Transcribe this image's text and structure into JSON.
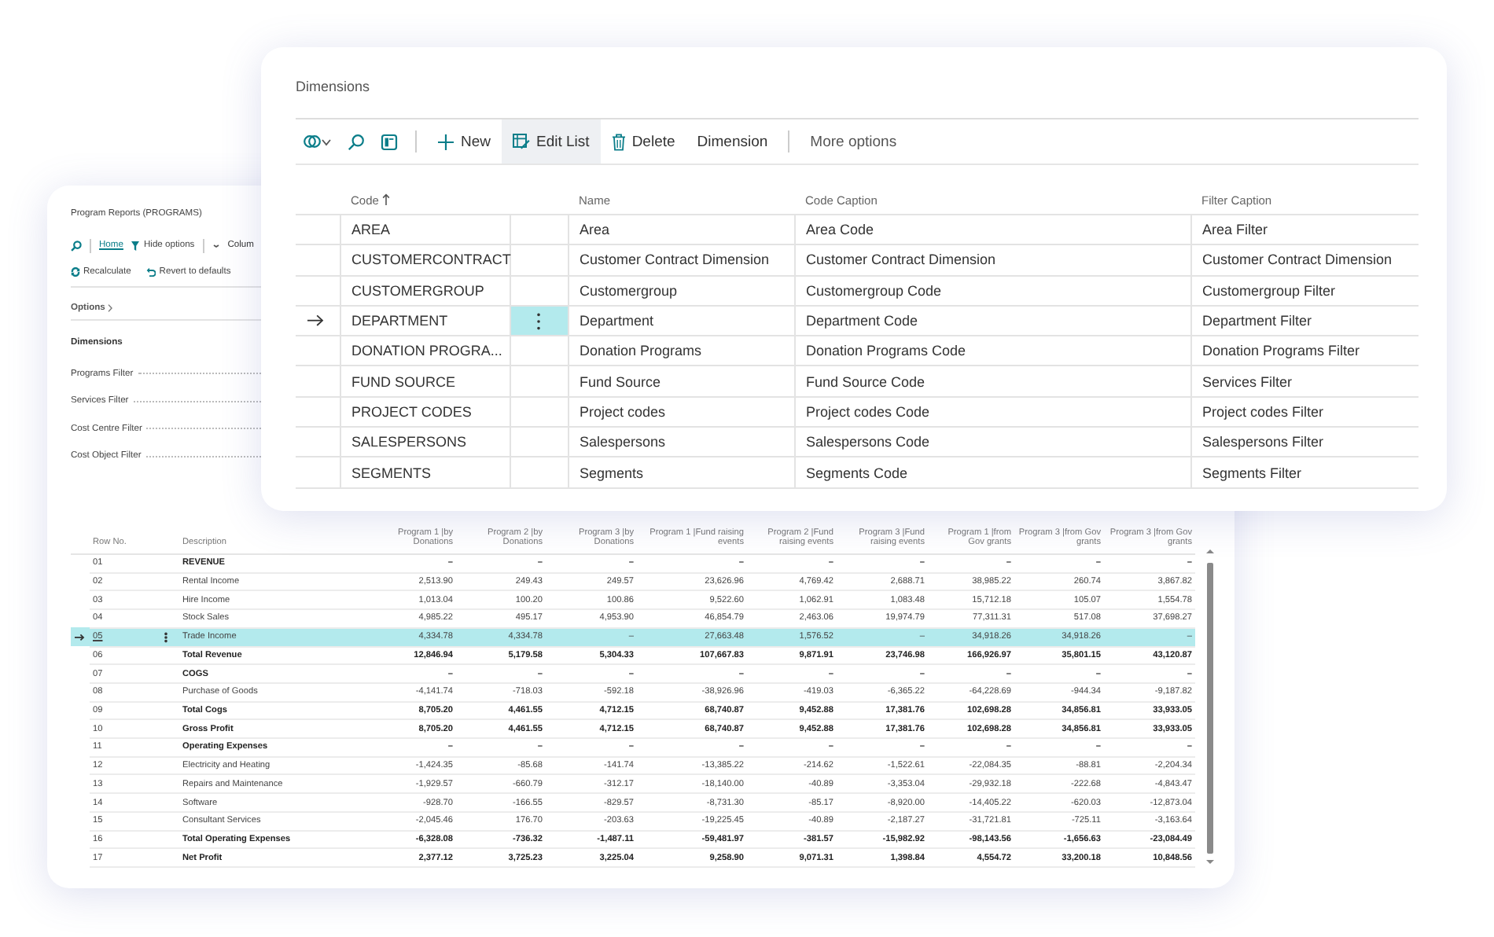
{
  "report_page": {
    "title": "Program Reports (PROGRAMS)",
    "tabs": [
      {
        "label": "Home",
        "selected": true
      }
    ],
    "hide_options": "Hide options",
    "column_cut": "Colum",
    "actions": [
      {
        "kind": "recalculate",
        "label": "Recalculate"
      },
      {
        "kind": "revert",
        "label": "Revert to defaults"
      }
    ],
    "options_label": "Options",
    "dimensions_label": "Dimensions",
    "filters": [
      "Programs Filter",
      "Services Filter",
      "Cost Centre Filter",
      "Cost Object Filter"
    ],
    "table": {
      "columns": [
        "Row No.",
        "Description",
        "Program 1 |by Donations",
        "Program 2 |by Donations",
        "Program 3 |by Donations",
        "Program 1 |Fund raising events",
        "Program 2 |Fund raising events",
        "Program 3 |Fund raising events",
        "Program 1 |from Gov grants",
        "Program 3 |from Gov grants",
        "Program 3 |from Gov grants"
      ],
      "rows": [
        {
          "no": "01",
          "kind": "heading",
          "description": "REVENUE",
          "selected": false,
          "values": [
            "–",
            "–",
            "–",
            "–",
            "–",
            "–",
            "–",
            "–",
            "–"
          ]
        },
        {
          "no": "02",
          "kind": "line",
          "description": "Rental Income",
          "selected": false,
          "values": [
            "2,513.90",
            "249.43",
            "249.57",
            "23,626.96",
            "4,769.42",
            "2,688.71",
            "38,985.22",
            "260.74",
            "3,867.82"
          ]
        },
        {
          "no": "03",
          "kind": "line",
          "description": "Hire Income",
          "selected": false,
          "values": [
            "1,013.04",
            "100.20",
            "100.86",
            "9,522.60",
            "1,062.91",
            "1,083.48",
            "15,712.18",
            "105.07",
            "1,554.78"
          ]
        },
        {
          "no": "04",
          "kind": "line",
          "description": "Stock Sales",
          "selected": false,
          "values": [
            "4,985.22",
            "495.17",
            "4,953.90",
            "46,854.79",
            "2,463.06",
            "19,974.79",
            "77,311.31",
            "517.08",
            "37,698.27"
          ]
        },
        {
          "no": "05",
          "kind": "line",
          "description": "Trade Income",
          "selected": true,
          "values": [
            "4,334.78",
            "4,334.78",
            "–",
            "27,663.48",
            "1,576.52",
            "–",
            "34,918.26",
            "34,918.26",
            "–"
          ]
        },
        {
          "no": "06",
          "kind": "total",
          "description": "Total Revenue",
          "selected": false,
          "values": [
            "12,846.94",
            "5,179.58",
            "5,304.33",
            "107,667.83",
            "9,871.91",
            "23,746.98",
            "166,926.97",
            "35,801.15",
            "43,120.87"
          ]
        },
        {
          "no": "07",
          "kind": "heading",
          "description": "COGS",
          "selected": false,
          "values": [
            "–",
            "–",
            "–",
            "–",
            "–",
            "–",
            "–",
            "–",
            "–"
          ]
        },
        {
          "no": "08",
          "kind": "line",
          "description": "Purchase of Goods",
          "selected": false,
          "values": [
            "-4,141.74",
            "-718.03",
            "-592.18",
            "-38,926.96",
            "-419.03",
            "-6,365.22",
            "-64,228.69",
            "-944.34",
            "-9,187.82"
          ]
        },
        {
          "no": "09",
          "kind": "total",
          "description": "Total Cogs",
          "selected": false,
          "values": [
            "8,705.20",
            "4,461.55",
            "4,712.15",
            "68,740.87",
            "9,452.88",
            "17,381.76",
            "102,698.28",
            "34,856.81",
            "33,933.05"
          ]
        },
        {
          "no": "10",
          "kind": "total",
          "description": "Gross Profit",
          "selected": false,
          "values": [
            "8,705.20",
            "4,461.55",
            "4,712.15",
            "68,740.87",
            "9,452.88",
            "17,381.76",
            "102,698.28",
            "34,856.81",
            "33,933.05"
          ]
        },
        {
          "no": "11",
          "kind": "heading",
          "description": "Operating Expenses",
          "selected": false,
          "values": [
            "–",
            "–",
            "–",
            "–",
            "–",
            "–",
            "–",
            "–",
            "–"
          ]
        },
        {
          "no": "12",
          "kind": "line",
          "description": "Electricity and Heating",
          "selected": false,
          "values": [
            "-1,424.35",
            "-85.68",
            "-141.74",
            "-13,385.22",
            "-214.62",
            "-1,522.61",
            "-22,084.35",
            "-88.81",
            "-2,204.34"
          ]
        },
        {
          "no": "13",
          "kind": "line",
          "description": "Repairs and Maintenance",
          "selected": false,
          "values": [
            "-1,929.57",
            "-660.79",
            "-312.17",
            "-18,140.00",
            "-40.89",
            "-3,353.04",
            "-29,932.18",
            "-222.68",
            "-4,843.47"
          ]
        },
        {
          "no": "14",
          "kind": "line",
          "description": "Software",
          "selected": false,
          "values": [
            "-928.70",
            "-166.55",
            "-829.57",
            "-8,731.30",
            "-85.17",
            "-8,920.00",
            "-14,405.22",
            "-620.03",
            "-12,873.04"
          ]
        },
        {
          "no": "15",
          "kind": "line",
          "description": "Consultant Services",
          "selected": false,
          "values": [
            "-2,045.46",
            "176.70",
            "-203.63",
            "-19,225.45",
            "-40.89",
            "-2,187.27",
            "-31,721.81",
            "-725.11",
            "-3,163.64"
          ]
        },
        {
          "no": "16",
          "kind": "total",
          "description": "Total Operating Expenses",
          "selected": false,
          "values": [
            "-6,328.08",
            "-736.32",
            "-1,487.11",
            "-59,481.97",
            "-381.57",
            "-15,982.92",
            "-98,143.56",
            "-1,656.63",
            "-23,084.49"
          ]
        },
        {
          "no": "17",
          "kind": "net",
          "description": "Net Profit",
          "selected": false,
          "values": [
            "2,377.12",
            "3,725.23",
            "3,225.04",
            "9,258.90",
            "9,071.31",
            "1,398.84",
            "4,554.72",
            "33,200.18",
            "10,848.56"
          ]
        }
      ]
    }
  },
  "dimensions_dialog": {
    "title": "Dimensions",
    "actions": [
      {
        "kind": "new",
        "label": "New",
        "selected": false
      },
      {
        "kind": "edit",
        "label": "Edit List",
        "selected": true
      },
      {
        "kind": "delete",
        "label": "Delete",
        "selected": false
      },
      {
        "kind": "plain",
        "label": "Dimension",
        "selected": false
      },
      {
        "kind": "more",
        "label": "More options",
        "selected": false
      }
    ],
    "table": {
      "columns": [
        "Code",
        "Name",
        "Code Caption",
        "Filter Caption"
      ],
      "rows": [
        {
          "code": "AREA",
          "name": "Area",
          "code_caption": "Area Code",
          "filter_caption": "Area Filter",
          "selected": false
        },
        {
          "code": "CUSTOMERCONTRACT",
          "name": "Customer Contract Dimension",
          "code_caption": "Customer Contract Dimension",
          "filter_caption": "Customer Contract Dimension",
          "selected": false
        },
        {
          "code": "CUSTOMERGROUP",
          "name": "Customergroup",
          "code_caption": "Customergroup Code",
          "filter_caption": "Customergroup Filter",
          "selected": false
        },
        {
          "code": "DEPARTMENT",
          "name": "Department",
          "code_caption": "Department Code",
          "filter_caption": "Department Filter",
          "selected": true
        },
        {
          "code": "DONATION PROGRA...",
          "name": "Donation Programs",
          "code_caption": "Donation Programs Code",
          "filter_caption": "Donation Programs Filter",
          "selected": false
        },
        {
          "code": "FUND SOURCE",
          "name": "Fund Source",
          "code_caption": "Fund Source Code",
          "filter_caption": "Services Filter",
          "selected": false
        },
        {
          "code": "PROJECT CODES",
          "name": "Project codes",
          "code_caption": "Project codes Code",
          "filter_caption": "Project codes Filter",
          "selected": false
        },
        {
          "code": "SALESPERSONS",
          "name": "Salespersons",
          "code_caption": "Salespersons Code",
          "filter_caption": "Salespersons Filter",
          "selected": false
        },
        {
          "code": "SEGMENTS",
          "name": "Segments",
          "code_caption": "Segments Code",
          "filter_caption": "Segments Filter",
          "selected": false
        }
      ]
    }
  }
}
